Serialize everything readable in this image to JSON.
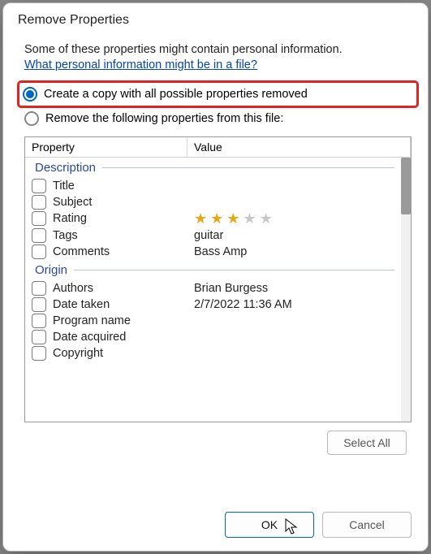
{
  "title": "Remove Properties",
  "intro": "Some of these properties might contain personal information.",
  "link": "What personal information might be in a file?",
  "options": {
    "create_copy": "Create a copy with all possible properties removed",
    "remove_following": "Remove the following properties from this file:"
  },
  "columns": {
    "property": "Property",
    "value": "Value"
  },
  "groups": [
    {
      "name": "Description",
      "rows": [
        {
          "label": "Title",
          "value": ""
        },
        {
          "label": "Subject",
          "value": ""
        },
        {
          "label": "Rating",
          "value": "",
          "rating": 3
        },
        {
          "label": "Tags",
          "value": "guitar"
        },
        {
          "label": "Comments",
          "value": "Bass Amp"
        }
      ]
    },
    {
      "name": "Origin",
      "rows": [
        {
          "label": "Authors",
          "value": "Brian Burgess"
        },
        {
          "label": "Date taken",
          "value": "2/7/2022 11:36 AM"
        },
        {
          "label": "Program name",
          "value": ""
        },
        {
          "label": "Date acquired",
          "value": ""
        },
        {
          "label": "Copyright",
          "value": ""
        }
      ]
    }
  ],
  "buttons": {
    "select_all": "Select All",
    "ok": "OK",
    "cancel": "Cancel"
  }
}
